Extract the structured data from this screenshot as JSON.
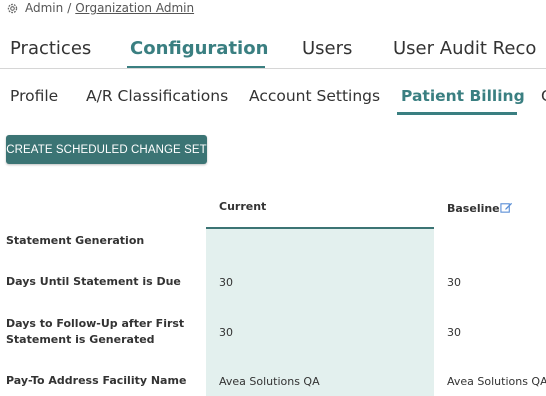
{
  "breadcrumb": {
    "root": "Admin",
    "separator": "/",
    "current": "Organization Admin"
  },
  "top_tabs": {
    "practices": "Practices",
    "configuration": "Configuration",
    "users": "Users",
    "user_audit": "User Audit Reco"
  },
  "sub_tabs": {
    "profile": "Profile",
    "ar_classifications": "A/R Classifications",
    "account_settings": "Account Settings",
    "patient_billing": "Patient Billing",
    "next_partial": "C"
  },
  "actions": {
    "create_change_set": "CREATE SCHEDULED CHANGE SET"
  },
  "table": {
    "headers": {
      "current": "Current",
      "baseline": "Baseline"
    },
    "rows": [
      {
        "label": "Statement Generation",
        "current": "",
        "baseline": ""
      },
      {
        "label": "Days Until Statement is Due",
        "current": "30",
        "baseline": "30"
      },
      {
        "label": "Days to Follow-Up after First Statement is Generated",
        "label_line1": "Days to Follow-Up after First",
        "label_line2": "Statement is Generated",
        "current": "30",
        "baseline": "30"
      },
      {
        "label": "Pay-To Address Facility Name",
        "current": "Avea Solutions QA",
        "baseline": "Avea Solutions QA"
      }
    ]
  },
  "icons": {
    "breadcrumb": "gear-icon",
    "baseline_edit": "edit-icon"
  },
  "colors": {
    "accent": "#3a7f81",
    "button": "#3b7474",
    "current_column": "#e3f0ee",
    "link_icon": "#5b8fd6"
  }
}
